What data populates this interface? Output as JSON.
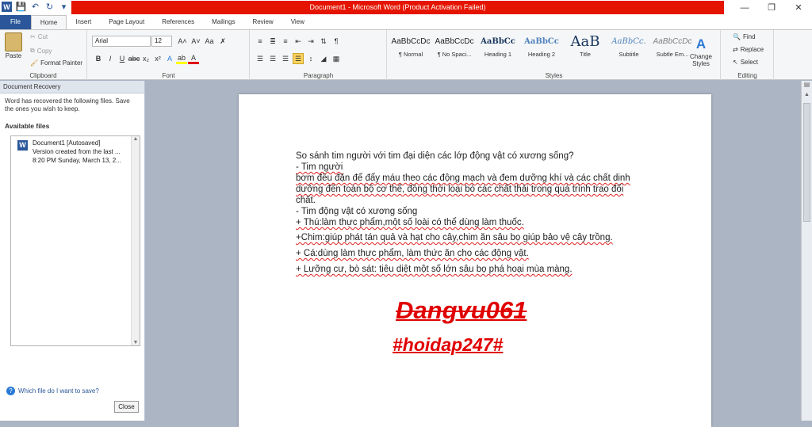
{
  "window": {
    "title": "Document1 - Microsoft Word (Product Activation Failed)",
    "logo": "W"
  },
  "tabs": [
    "File",
    "Home",
    "Insert",
    "Page Layout",
    "References",
    "Mailings",
    "Review",
    "View"
  ],
  "clipboard": {
    "paste": "Paste",
    "cut": "Cut",
    "copy": "Copy",
    "format_painter": "Format Painter",
    "label": "Clipboard"
  },
  "font": {
    "name": "Arial",
    "size": "12",
    "label": "Font"
  },
  "paragraph": {
    "label": "Paragraph"
  },
  "styles": {
    "label": "Styles",
    "items": [
      {
        "preview": "AaBbCcDc",
        "name": "¶ Normal"
      },
      {
        "preview": "AaBbCcDc",
        "name": "¶ No Spaci..."
      },
      {
        "preview": "AaBbCc",
        "name": "Heading 1"
      },
      {
        "preview": "AaBbCc",
        "name": "Heading 2"
      },
      {
        "preview": "AaB",
        "name": "Title"
      },
      {
        "preview": "AaBbCc.",
        "name": "Subtitle"
      },
      {
        "preview": "AaBbCcDc",
        "name": "Subtle Em..."
      }
    ],
    "change": "Change Styles"
  },
  "editing": {
    "find": "Find",
    "replace": "Replace",
    "select": "Select",
    "label": "Editing"
  },
  "recovery": {
    "title": "Document Recovery",
    "message": "Word has recovered the following files.  Save the ones you wish to keep.",
    "available": "Available files",
    "file_name": "Document1  [Autosaved]",
    "file_line2": "Version created from the last ...",
    "file_line3": "8:20 PM Sunday, March 13, 2...",
    "help_link": "Which file do I want to save?",
    "close": "Close"
  },
  "document": {
    "lines": [
      "So sánh tim người với tim đại diện các lớp động vật có xương sống?",
      "- Tim người",
      "bơm đều đặn để đẩy máu theo các động mạch và đem dưỡng khí và các chất dinh",
      "dưỡng đến toàn bộ cơ thể, đồng thời loại bỏ các chất thải trong quá trình trao đổi",
      "chất.",
      "- Tim động vật có xương sống",
      "+ Thú:làm thực phẩm,một số loài có thể dùng làm thuốc.",
      "+Chim:giúp phát tán quả và hạt cho cây,chim ăn sâu bọ giúp bảo vệ cây trồng.",
      "+ Cá:dùng làm thực phẩm, làm thức ăn cho các động vật.",
      "+ Lưỡng cư, bò sát: tiêu diệt một số lớn sâu bọ phá hoại mùa màng."
    ],
    "signature": "Dangvu061",
    "hashtag": "#hoidap247#"
  }
}
